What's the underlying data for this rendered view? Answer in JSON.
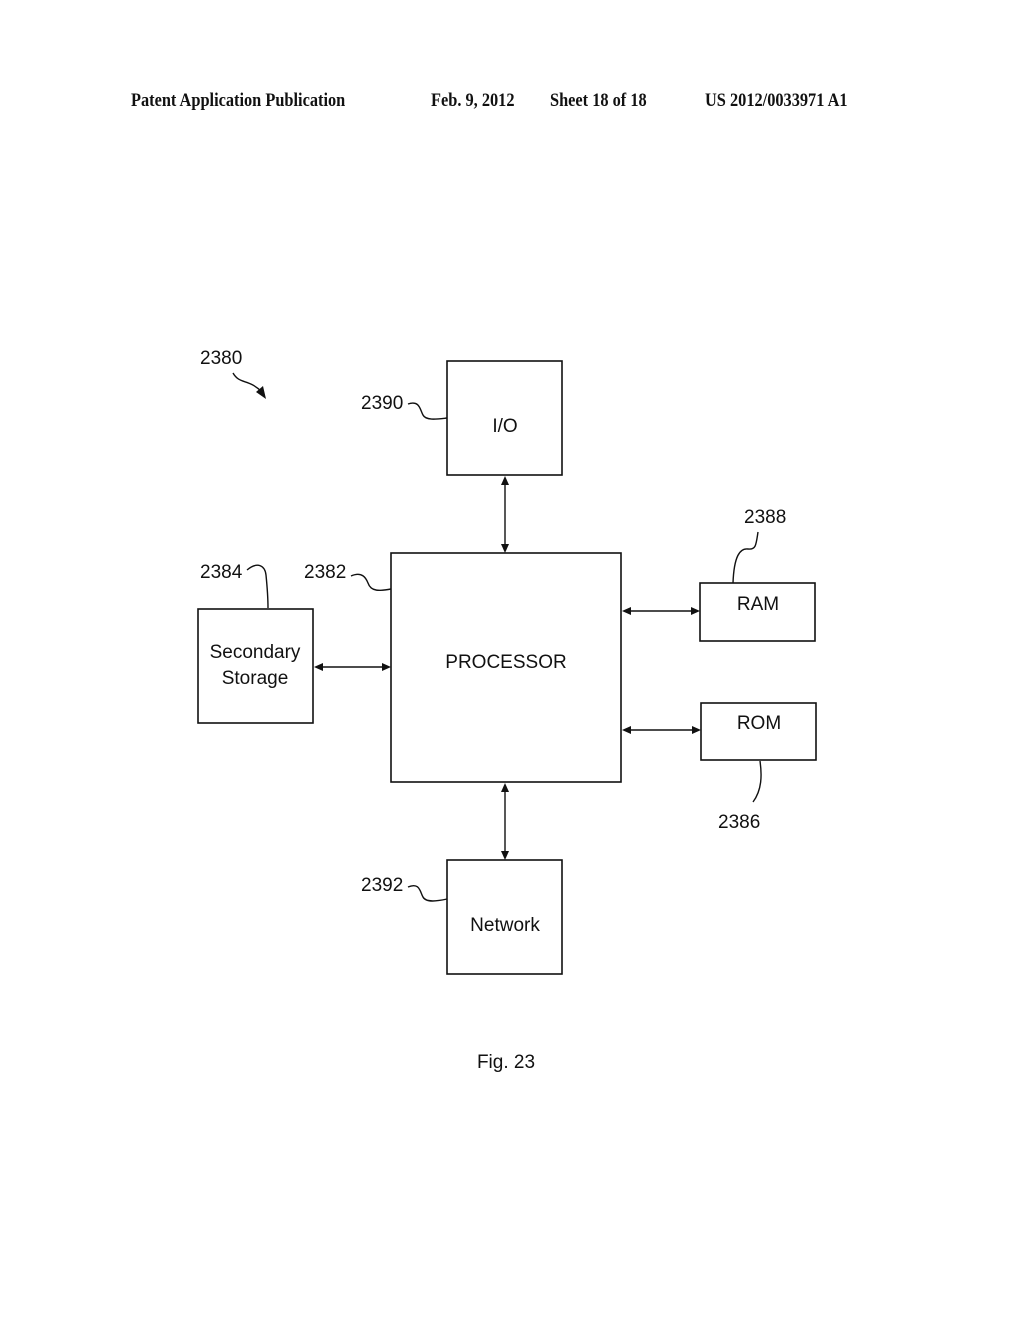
{
  "header": {
    "publication": "Patent Application Publication",
    "date": "Feb. 9, 2012",
    "sheet": "Sheet 18 of 18",
    "number": "US 2012/0033971 A1"
  },
  "diagram": {
    "system_ref": "2380",
    "blocks": {
      "io": {
        "label": "I/O",
        "ref": "2390"
      },
      "processor": {
        "label": "PROCESSOR",
        "ref": "2382"
      },
      "secondary_storage": {
        "label_line1": "Secondary",
        "label_line2": "Storage",
        "ref": "2384"
      },
      "ram": {
        "label": "RAM",
        "ref": "2388"
      },
      "rom": {
        "label": "ROM",
        "ref": "2386"
      },
      "network": {
        "label": "Network",
        "ref": "2392"
      }
    },
    "connections": [
      {
        "from": "processor",
        "to": "io",
        "type": "bidirectional"
      },
      {
        "from": "processor",
        "to": "secondary_storage",
        "type": "bidirectional"
      },
      {
        "from": "processor",
        "to": "ram",
        "type": "bidirectional"
      },
      {
        "from": "processor",
        "to": "rom",
        "type": "bidirectional"
      },
      {
        "from": "processor",
        "to": "network",
        "type": "bidirectional"
      }
    ]
  },
  "caption": "Fig. 23"
}
